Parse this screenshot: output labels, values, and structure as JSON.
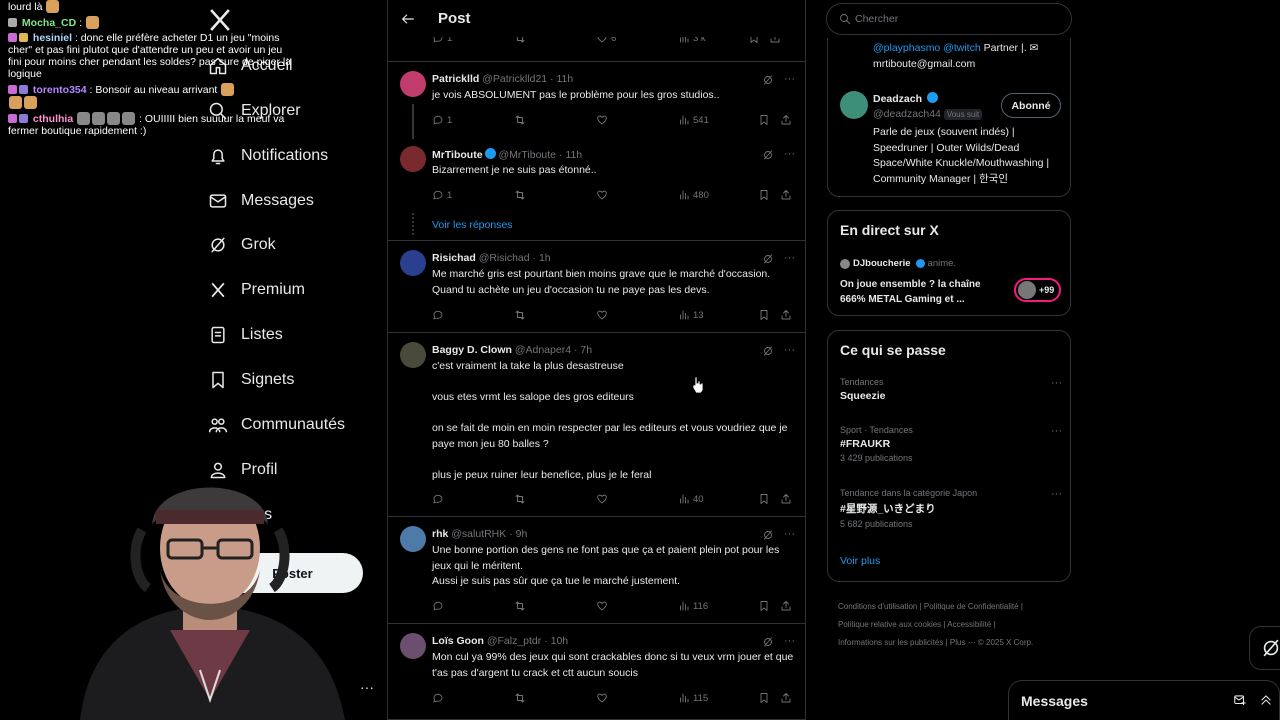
{
  "chat": [
    {
      "user": "",
      "user_color": "#ffffff",
      "text": "lourd là"
    },
    {
      "user": "Mocha_CD",
      "user_color": "#7ee787",
      "text": ":"
    },
    {
      "user": "hesiniel",
      "user_color": "#a8d8ff",
      "text": ": donc elle préfère acheter D1 un jeu \"moins cher\" et pas fini plutot que d'attendre un peu et avoir un jeu fini pour moins cher pendant les soldes? pas sure de piger la logique"
    },
    {
      "user": "torento354",
      "user_color": "#b388ff",
      "text": ": Bonsoir au niveau arrivant"
    },
    {
      "user": "cthulhia",
      "user_color": "#ff8fd1",
      "text": ": OUIIIII bien suuuur la meuf va fermer boutique rapidement :)"
    }
  ],
  "nav": {
    "items": [
      "Accueil",
      "Explorer",
      "Notifications",
      "Messages",
      "Grok",
      "Premium",
      "Listes",
      "Signets",
      "Communautés",
      "Profil",
      "Plus"
    ],
    "post_label": "Poster"
  },
  "header": {
    "title": "Post"
  },
  "top_actions": {
    "replies": "1",
    "likes": "6",
    "views": "3 k"
  },
  "tweets": [
    {
      "name": "Patricklld",
      "handle": "@Patricklld21 · 11h",
      "verified": false,
      "text": "je vois ABSOLUMENT pas le problème pour les gros studios..",
      "replies": "1",
      "retweets": "",
      "likes": "",
      "views": "541",
      "avatar": "#c23b6d"
    },
    {
      "name": "MrTiboute",
      "handle": "@MrTiboute · 11h",
      "verified": true,
      "text": "Bizarrement je ne suis pas étonné..",
      "replies": "1",
      "retweets": "",
      "likes": "",
      "views": "480",
      "avatar": "#7a2a2f",
      "show_replies": "Voir les réponses"
    },
    {
      "name": "Risichad",
      "handle": "@Risichad · 1h",
      "verified": false,
      "text": "Me marché gris est pourtant bien moins grave que le marché d'occasion.\nQuand tu achète un jeu d'occasion tu ne paye pas les devs.",
      "replies": "",
      "retweets": "",
      "likes": "",
      "views": "13",
      "avatar": "#2b3f8f"
    },
    {
      "name": "Baggy D. Clown",
      "handle": "@Adnaper4 · 7h",
      "verified": false,
      "text": "c'est vraiment la take la plus desastreuse\n\nvous etes vrmt les salope des gros editeurs\n\non se fait de moin en moin respecter par les editeurs et vous voudriez que je paye mon jeu 80 balles ?\n\nplus je peux ruiner leur benefice, plus je le feral",
      "replies": "",
      "retweets": "",
      "likes": "",
      "views": "40",
      "avatar": "#4a4a3a"
    },
    {
      "name": "rhk",
      "handle": "@salutRHK · 9h",
      "verified": false,
      "text": "Une bonne portion des gens ne font pas que ça et paient plein pot pour les jeux qui le méritent.\nAussi je suis pas sûr que ça tue le marché justement.",
      "replies": "",
      "retweets": "",
      "likes": "",
      "views": "116",
      "avatar": "#4d7aa8"
    },
    {
      "name": "Loïs Goon",
      "handle": "@Falz_ptdr · 10h",
      "verified": false,
      "text": "Mon cul ya 99% des jeux qui sont crackables donc si tu veux vrm jouer et que t'as pas d'argent tu crack et ctt aucun soucis",
      "replies": "",
      "retweets": "",
      "likes": "",
      "views": "115",
      "avatar": "#6b4f6e"
    }
  ],
  "search": {
    "placeholder": "Chercher"
  },
  "follow_card": {
    "bio_tail_links": "@playphasmo @twitch",
    "bio_tail_text": "Partner |.",
    "email": "mrtiboute@gmail.com",
    "name": "Deadzach",
    "handle": "@deadzach44",
    "follows_you": "Vous suit",
    "button": "Abonné",
    "bio": "Parle de jeux (souvent indés) | Speedruner | Outer Wilds/Dead Space/White Knuckle/Mouthwashing | Community Manager | 한국인"
  },
  "live": {
    "title": "En direct sur X",
    "host": "DJboucherie",
    "host_suffix": "anime.",
    "text": "On joue ensemble ?  la chaîne 666% METAL  Gaming et ...",
    "count": "+99"
  },
  "trends": {
    "title": "Ce qui se passe",
    "items": [
      {
        "context": "Tendances",
        "name": "Squeezie",
        "count": ""
      },
      {
        "context": "Sport · Tendances",
        "name": "#FRAUKR",
        "count": "3 429 publications"
      },
      {
        "context": "Tendance dans la catégorie Japon",
        "name": "#星野源_いきどまり",
        "count": "5 682 publications"
      }
    ],
    "more": "Voir plus"
  },
  "footer": {
    "line1": "Conditions d'utilisation  |  Politique de Confidentialité  |",
    "line2": "Politique relative aux cookies  |  Accessibilité  |",
    "line3": "Informations sur les publicités  |  Plus ···  © 2025 X Corp."
  },
  "messages": {
    "title": "Messages"
  },
  "colors": {
    "accent": "#1d9bf0",
    "background": "#000000",
    "border": "#2f3336",
    "muted": "#71767b"
  }
}
